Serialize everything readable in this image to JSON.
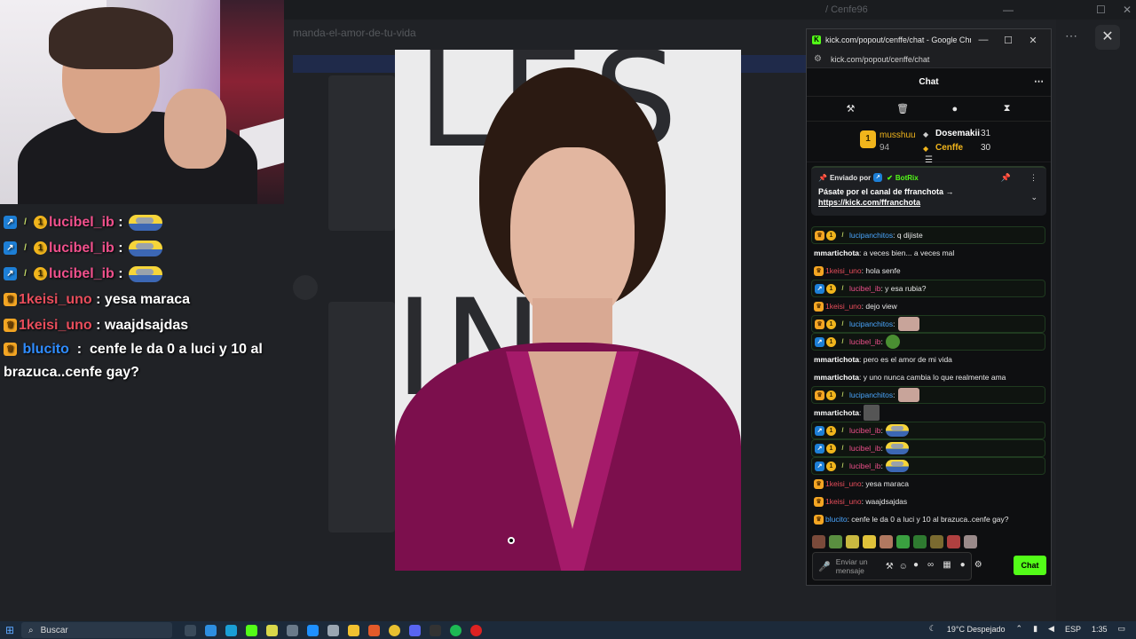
{
  "background_app": {
    "window_title": "/ Cenfe96",
    "channel_name": "manda-el-amor-de-tu-vida",
    "close_glyph": "✕",
    "more_glyph": "⋯"
  },
  "stream_overlay_chat": [
    {
      "user": "lucibel_ib",
      "color": "pink",
      "badges": [
        "vip",
        "sword",
        "sub"
      ],
      "text": "",
      "emote": "minion"
    },
    {
      "user": "lucibel_ib",
      "color": "pink",
      "badges": [
        "vip",
        "sword",
        "sub"
      ],
      "text": "",
      "emote": "minion"
    },
    {
      "user": "lucibel_ib",
      "color": "pink",
      "badges": [
        "vip",
        "sword",
        "sub"
      ],
      "text": "",
      "emote": "minion"
    },
    {
      "user": "1keisi_uno",
      "color": "red",
      "badges": [
        "crown"
      ],
      "text": "yesa maraca"
    },
    {
      "user": "1keisi_uno",
      "color": "red",
      "badges": [
        "crown"
      ],
      "text": "waajdsajdas"
    },
    {
      "user": "blucito",
      "color": "blue",
      "badges": [
        "crown"
      ],
      "text": "cenfe le da 0 a luci y 10 al brazuca..cenfe gay?"
    }
  ],
  "chrome_popup": {
    "title": "kick.com/popout/cenffe/chat - Google Chrome",
    "url": "kick.com/popout/cenffe/chat",
    "favicon": "K",
    "min": "—",
    "max": "☐",
    "close": "✕"
  },
  "kick_chat": {
    "header_title": "Chat",
    "menu_glyph": "⋯",
    "mod_tools": [
      "hammer-icon",
      "trash-icon",
      "chat-bubble-icon",
      "hourglass-icon"
    ],
    "leaderboard": {
      "first": {
        "rank": "1",
        "name": "musshuu",
        "value": "94"
      },
      "second": {
        "name": "Dosemakii",
        "value": "31"
      },
      "third": {
        "name": "Cenffe",
        "value": "30"
      }
    },
    "pinned": {
      "sent_by": "Enviado por",
      "bot": "BotRix",
      "text": "Pásate por el canal de ffranchota →",
      "link": "https://kick.com/ffranchota"
    },
    "messages": [
      {
        "user": "lucipanchitos",
        "color": "blue",
        "badges": [
          "crown",
          "sub",
          "sword"
        ],
        "text": ": q dijiste",
        "highlight": true
      },
      {
        "user": "mmartichota",
        "color": "white",
        "badges": [],
        "text": ": a veces bien... a veces mal",
        "highlight": false
      },
      {
        "user": "1keisi_uno",
        "color": "red",
        "badges": [
          "crown"
        ],
        "text": ": hola senfe",
        "highlight": false
      },
      {
        "user": "lucibel_ib",
        "color": "pink",
        "badges": [
          "vip",
          "sub",
          "sword"
        ],
        "text": ": y esa rubia?",
        "highlight": true
      },
      {
        "user": "1keisi_uno",
        "color": "red",
        "badges": [
          "crown"
        ],
        "text": ": dejo view",
        "highlight": false
      },
      {
        "user": "lucipanchitos",
        "color": "blue",
        "badges": [
          "crown",
          "sub",
          "sword"
        ],
        "text": ":",
        "emote": "face",
        "highlight": true
      },
      {
        "user": "lucibel_ib",
        "color": "pink",
        "badges": [
          "vip",
          "sub",
          "sword"
        ],
        "text": ":",
        "emote": "green",
        "highlight": true
      },
      {
        "user": "mmartichota",
        "color": "white",
        "badges": [],
        "text": ": pero es el amor de mi vida",
        "highlight": false
      },
      {
        "user": "mmartichota",
        "color": "white",
        "badges": [],
        "text": ": y uno nunca cambia lo que realmente ama",
        "highlight": false
      },
      {
        "user": "lucipanchitos",
        "color": "blue",
        "badges": [
          "crown",
          "sub",
          "sword"
        ],
        "text": ":",
        "emote": "face",
        "highlight": true
      },
      {
        "user": "mmartichota",
        "color": "white",
        "badges": [],
        "text": ":",
        "emote": "cat",
        "highlight": false
      },
      {
        "user": "lucibel_ib",
        "color": "pink",
        "badges": [
          "vip",
          "sub",
          "sword"
        ],
        "text": ":",
        "emote": "minion",
        "highlight": true
      },
      {
        "user": "lucibel_ib",
        "color": "pink",
        "badges": [
          "vip",
          "sub",
          "sword"
        ],
        "text": ":",
        "emote": "minion",
        "highlight": true
      },
      {
        "user": "lucibel_ib",
        "color": "pink",
        "badges": [
          "vip",
          "sub",
          "sword"
        ],
        "text": ":",
        "emote": "minion",
        "highlight": true
      },
      {
        "user": "1keisi_uno",
        "color": "red",
        "badges": [
          "crown"
        ],
        "text": ": yesa maraca",
        "highlight": false
      },
      {
        "user": "1keisi_uno",
        "color": "red",
        "badges": [
          "crown"
        ],
        "text": ": waajdsajdas",
        "highlight": false
      },
      {
        "user": "blucito",
        "color": "blue",
        "badges": [
          "crown"
        ],
        "text": ": cenfe le da 0 a luci y 10 al brazuca..cenfe gay?",
        "highlight": false
      }
    ],
    "input_placeholder": "Enviar un mensaje",
    "send_label": "Chat"
  },
  "taskbar": {
    "search_label": "Buscar",
    "weather": "19°C  Despejado",
    "lang": "ESP",
    "time": "1:35"
  },
  "colors": {
    "kick_green": "#53fc18",
    "name_pink": "#f0508c",
    "name_red": "#e84d5b",
    "name_blue": "#4aa6ff",
    "sub_gold": "#f1b51c"
  }
}
